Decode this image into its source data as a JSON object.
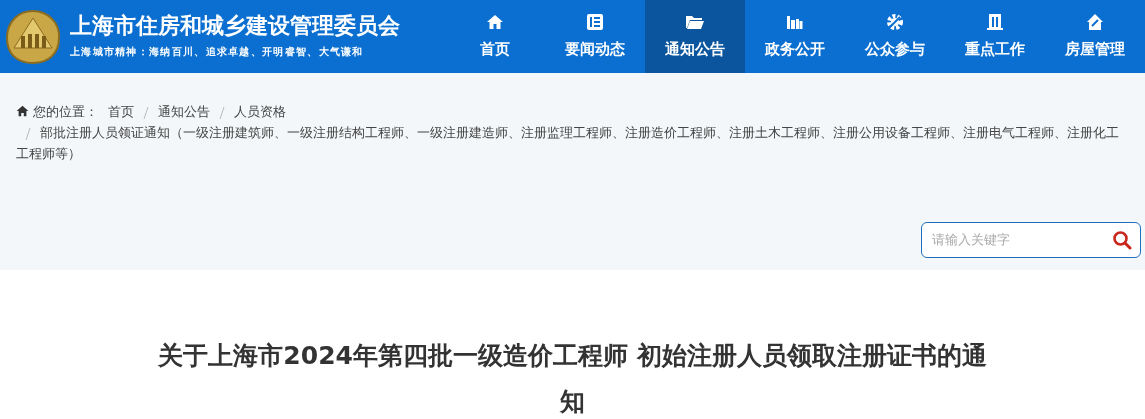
{
  "header": {
    "title": "上海市住房和城乡建设管理委员会",
    "slogan": "上海城市精神：海纳百川、追求卓越、开明睿智、大气谦和"
  },
  "nav": [
    {
      "label": "首页",
      "selected": false
    },
    {
      "label": "要闻动态",
      "selected": false
    },
    {
      "label": "通知公告",
      "selected": true
    },
    {
      "label": "政务公开",
      "selected": false
    },
    {
      "label": "公众参与",
      "selected": false
    },
    {
      "label": "重点工作",
      "selected": false
    },
    {
      "label": "房屋管理",
      "selected": false
    }
  ],
  "breadcrumb": {
    "label": "您的位置：",
    "items": [
      "首页",
      "通知公告",
      "人员资格",
      "部批注册人员领证通知（一级注册建筑师、一级注册结构工程师、一级注册建造师、注册监理工程师、注册造价工程师、注册土木工程师、注册公用设备工程师、注册电气工程师、注册化工工程师等）"
    ]
  },
  "search": {
    "placeholder": "请输入关键字"
  },
  "article": {
    "title": "关于上海市2024年第四批一级造价工程师 初始注册人员领取注册证书的通知"
  }
}
